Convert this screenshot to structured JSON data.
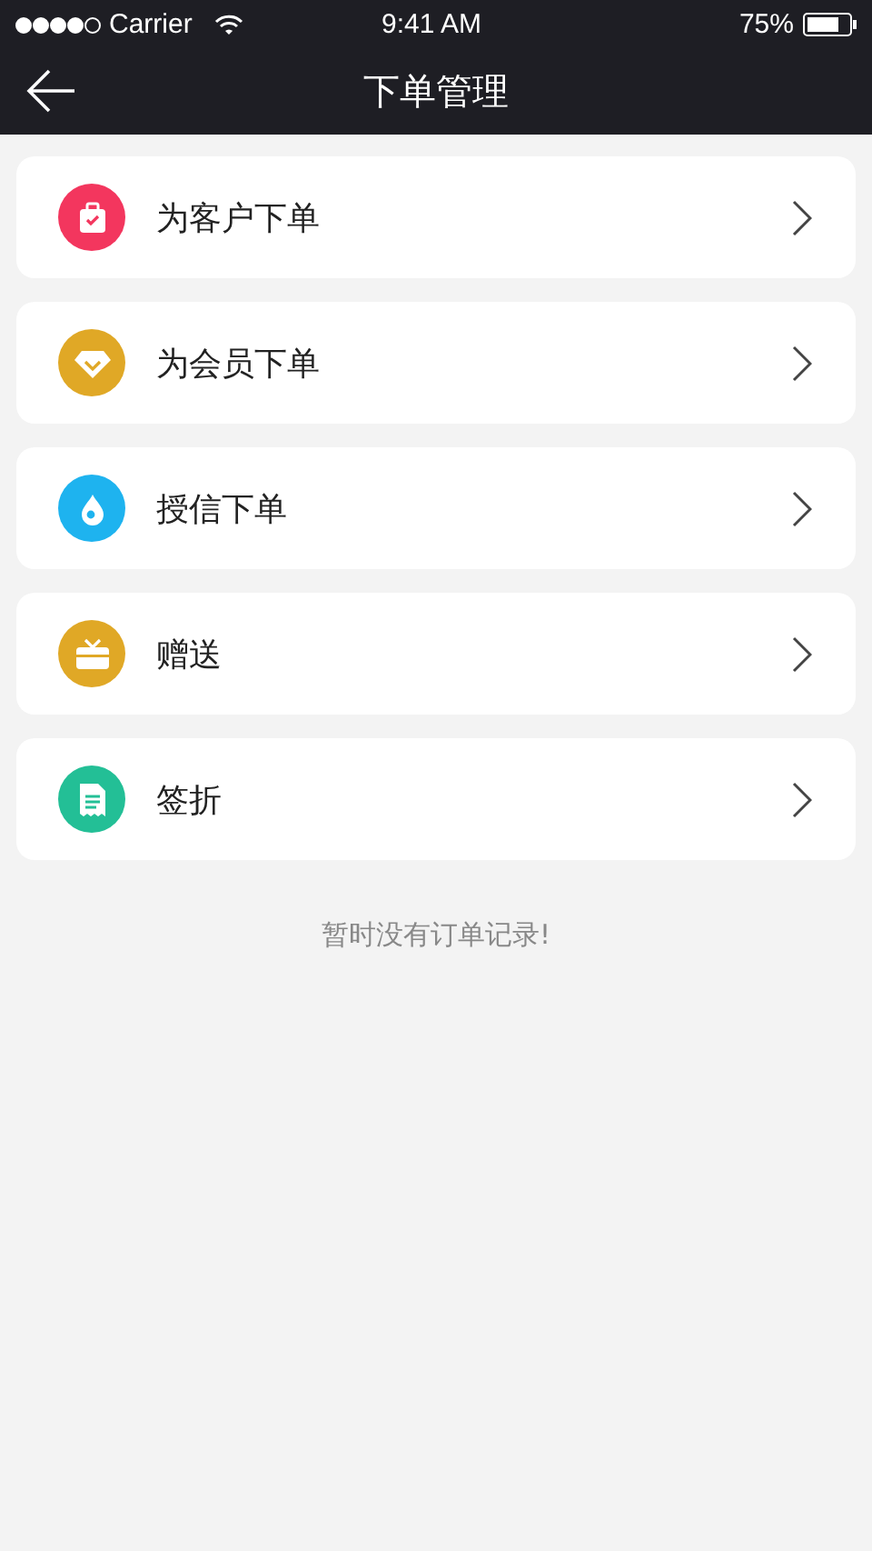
{
  "status_bar": {
    "carrier": "Carrier",
    "time": "9:41 AM",
    "battery": "75%"
  },
  "nav": {
    "title": "下单管理"
  },
  "items": [
    {
      "label": "为客户下单",
      "kind": "bag",
      "color": "#f3365e"
    },
    {
      "label": "为会员下单",
      "kind": "diamond",
      "color": "#e0a826"
    },
    {
      "label": "授信下单",
      "kind": "drop",
      "color": "#1eb3ef"
    },
    {
      "label": "赠送",
      "kind": "gift",
      "color": "#e0a826"
    },
    {
      "label": "签折",
      "kind": "receipt",
      "color": "#23bf96"
    }
  ],
  "empty_message": "暂时没有订单记录!"
}
